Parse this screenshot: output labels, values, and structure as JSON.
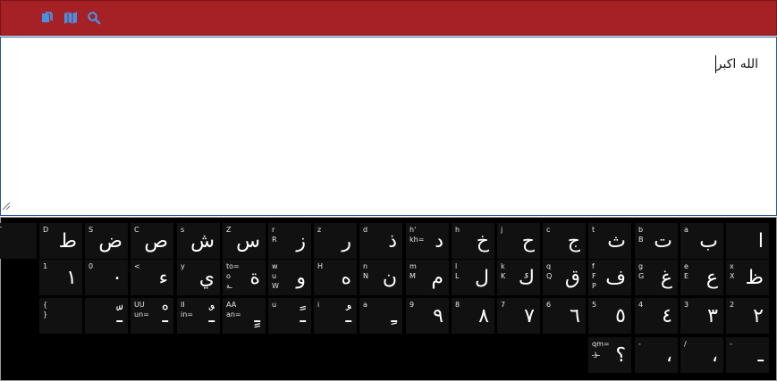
{
  "toolbar": {
    "icons": [
      "copy-icon",
      "map-icon",
      "search-icon"
    ],
    "colors": {
      "bar": "#a52125",
      "icon": "#4a90e2"
    }
  },
  "editor": {
    "text": "الله اكبر"
  },
  "keyboard": {
    "rows": [
      [
        {
          "top": "",
          "mid": "",
          "bot": "",
          "bot2": "",
          "glyph": "ا"
        },
        {
          "top": "a",
          "mid": "",
          "bot": "",
          "bot2": "",
          "glyph": "ب"
        },
        {
          "top": "b",
          "mid": "B",
          "bot": "",
          "bot2": "",
          "glyph": "ت"
        },
        {
          "top": "t",
          "mid": "",
          "bot": "",
          "bot2": "",
          "glyph": "ث"
        },
        {
          "top": "c",
          "mid": "",
          "bot": "",
          "bot2": "",
          "glyph": "ج"
        },
        {
          "top": "j",
          "mid": "",
          "bot": "",
          "bot2": "",
          "glyph": "ح"
        },
        {
          "top": "h",
          "mid": "",
          "bot": "",
          "bot2": "",
          "glyph": "خ"
        },
        {
          "top": "h'",
          "mid": "kh=",
          "bot": "",
          "bot2": "",
          "glyph": "د"
        },
        {
          "top": "d",
          "mid": "",
          "bot": "",
          "bot2": "",
          "glyph": "ذ"
        },
        {
          "top": "z",
          "mid": "",
          "bot": "",
          "bot2": "",
          "glyph": "ر"
        },
        {
          "top": "r",
          "mid": "R",
          "bot": "",
          "bot2": "",
          "glyph": "ز"
        },
        {
          "top": "Z",
          "mid": "",
          "bot": "",
          "bot2": "",
          "glyph": "س"
        },
        {
          "top": "s",
          "mid": "",
          "bot": "",
          "bot2": "",
          "glyph": "ش"
        },
        {
          "top": "C",
          "mid": "",
          "bot": "",
          "bot2": "",
          "glyph": "ص"
        },
        {
          "top": "S",
          "mid": "",
          "bot": "",
          "bot2": "",
          "glyph": "ض"
        },
        {
          "top": "D",
          "mid": "",
          "bot": "",
          "bot2": "",
          "glyph": "ط"
        },
        {
          "top": "T",
          "mid": "",
          "bot": "",
          "bot2": "",
          "glyph": ""
        }
      ],
      [
        {
          "top": "x",
          "mid": "X",
          "bot": "",
          "bot2": "",
          "glyph": "ظ"
        },
        {
          "top": "e",
          "mid": "E",
          "bot": "",
          "bot2": "",
          "glyph": "ع"
        },
        {
          "top": "g",
          "mid": "G",
          "bot": "",
          "bot2": "",
          "glyph": "غ"
        },
        {
          "top": "f",
          "mid": "F",
          "bot": "P",
          "bot2": "",
          "glyph": "ف"
        },
        {
          "top": "q",
          "mid": "Q",
          "bot": "",
          "bot2": "",
          "glyph": "ق"
        },
        {
          "top": "k",
          "mid": "K",
          "bot": "",
          "bot2": "",
          "glyph": "ك"
        },
        {
          "top": "l",
          "mid": "L",
          "bot": "",
          "bot2": "",
          "glyph": "ل"
        },
        {
          "top": "m",
          "mid": "M",
          "bot": "",
          "bot2": "",
          "glyph": "م"
        },
        {
          "top": "n",
          "mid": "N",
          "bot": "",
          "bot2": "",
          "glyph": "ن"
        },
        {
          "top": "H",
          "mid": "",
          "bot": "",
          "bot2": "",
          "glyph": "ه"
        },
        {
          "top": "w",
          "mid": "u",
          "bot": "W",
          "bot2": "",
          "glyph": "و"
        },
        {
          "top": "to=",
          "mid": "o",
          "bot": "ـة",
          "bot2": "",
          "glyph": "ة"
        },
        {
          "top": "y",
          "mid": "",
          "bot": "",
          "bot2": "",
          "glyph": "ي"
        },
        {
          "top": "<",
          "mid": "",
          "bot": "",
          "bot2": "",
          "glyph": "ء"
        },
        {
          "top": "0",
          "mid": "",
          "bot": "",
          "bot2": "",
          "glyph": "٠"
        },
        {
          "top": "1",
          "mid": "",
          "bot": "",
          "bot2": "",
          "glyph": "١"
        }
      ],
      [
        {
          "top": "2",
          "mid": "",
          "bot": "",
          "bot2": "",
          "glyph": "٢"
        },
        {
          "top": "3",
          "mid": "",
          "bot": "",
          "bot2": "",
          "glyph": "٣"
        },
        {
          "top": "4",
          "mid": "",
          "bot": "",
          "bot2": "",
          "glyph": "٤"
        },
        {
          "top": "5",
          "mid": "",
          "bot": "",
          "bot2": "",
          "glyph": "٥"
        },
        {
          "top": "6",
          "mid": "",
          "bot": "",
          "bot2": "",
          "glyph": "٦"
        },
        {
          "top": "7",
          "mid": "",
          "bot": "",
          "bot2": "",
          "glyph": "٧"
        },
        {
          "top": "8",
          "mid": "",
          "bot": "",
          "bot2": "",
          "glyph": "٨"
        },
        {
          "top": "9",
          "mid": "",
          "bot": "",
          "bot2": "",
          "glyph": "٩"
        },
        {
          "top": "a",
          "mid": "",
          "bot": "",
          "bot2": "",
          "glyph": "ـِ"
        },
        {
          "top": "i",
          "mid": "",
          "bot": "",
          "bot2": "",
          "glyph": "ـُ"
        },
        {
          "top": "u",
          "mid": "",
          "bot": "",
          "bot2": "",
          "glyph": "ـً"
        },
        {
          "top": "AA",
          "mid": "an=",
          "bot": "",
          "bot2": "",
          "glyph": "ـٍ"
        },
        {
          "top": "II",
          "mid": "in=",
          "bot": "",
          "bot2": "",
          "glyph": "ـٌ"
        },
        {
          "top": "UU",
          "mid": "un=",
          "bot": "",
          "bot2": "",
          "glyph": "ـْ"
        },
        {
          "top": "",
          "mid": "",
          "bot": "",
          "bot2": "",
          "glyph": "ـّ"
        },
        {
          "top": "{",
          "mid": "}",
          "bot": "",
          "bot2": "",
          "glyph": ""
        }
      ],
      [
        {
          "top": "-",
          "mid": "",
          "bot": "",
          "bot2": "",
          "glyph": "ـ"
        },
        {
          "top": "/",
          "mid": "",
          "bot": "",
          "bot2": "",
          "glyph": "،"
        },
        {
          "top": "-",
          "mid": "",
          "bot": "",
          "bot2": "",
          "glyph": "،"
        },
        {
          "top": "qm=",
          "mid": "ـؤـ",
          "bot": "",
          "bot2": "",
          "glyph": "؟"
        }
      ]
    ]
  }
}
